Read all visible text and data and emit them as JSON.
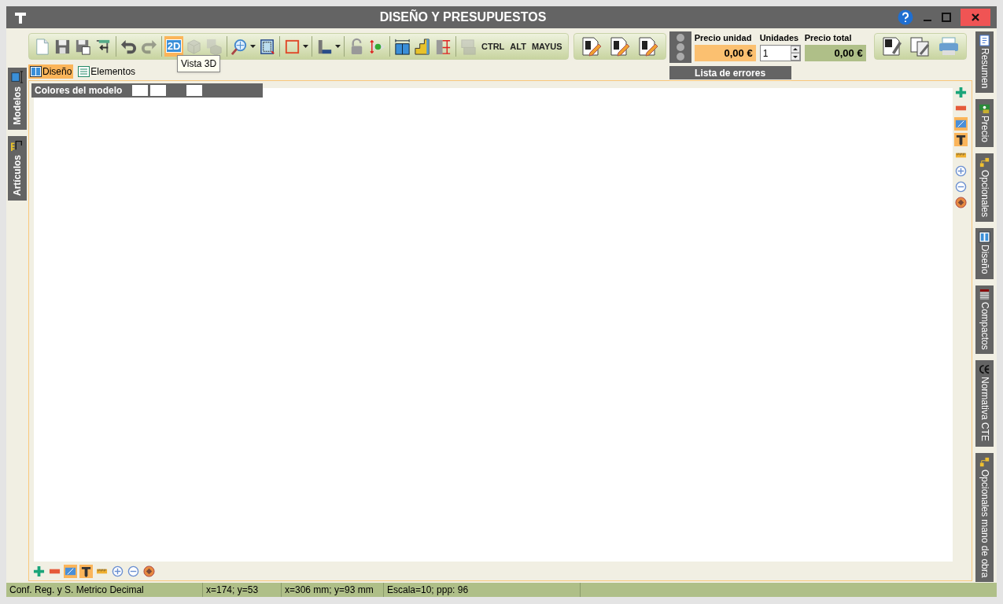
{
  "window": {
    "title": "DISEÑO Y PRESUPUESTOS"
  },
  "toolbar": {
    "sections": [
      [
        {
          "kind": "icon",
          "disabled": false,
          "selected": false
        },
        {
          "kind": "icon",
          "disabled": false,
          "selected": false
        },
        {
          "kind": "icon",
          "disabled": false,
          "selected": false
        },
        {
          "kind": "icon",
          "disabled": false,
          "selected": false
        }
      ],
      [
        {
          "kind": "icon",
          "disabled": false,
          "selected": false
        },
        {
          "kind": "icon",
          "disabled": true,
          "selected": false
        }
      ],
      [
        {
          "kind": "text",
          "label": "2D",
          "disabled": false,
          "selected": true
        },
        {
          "kind": "icon",
          "disabled": true,
          "selected": false
        },
        {
          "kind": "icon",
          "disabled": true,
          "selected": false
        }
      ],
      [
        {
          "kind": "dropdown",
          "disabled": false,
          "selected": false
        },
        {
          "kind": "icon",
          "disabled": false,
          "selected": false
        }
      ],
      [
        {
          "kind": "dropdown",
          "disabled": false,
          "selected": false
        }
      ],
      [
        {
          "kind": "dropdown",
          "disabled": false,
          "selected": false
        }
      ],
      [
        {
          "kind": "icon",
          "disabled": false,
          "selected": false
        },
        {
          "kind": "icon",
          "disabled": false,
          "selected": false
        }
      ],
      [
        {
          "kind": "icon",
          "disabled": false,
          "selected": false
        },
        {
          "kind": "icon",
          "disabled": false,
          "selected": false
        },
        {
          "kind": "icon",
          "disabled": false,
          "selected": false
        }
      ],
      [
        {
          "kind": "icon",
          "disabled": true,
          "selected": false
        },
        {
          "kind": "text",
          "label": "CTRL",
          "disabled": false,
          "selected": false
        },
        {
          "kind": "text",
          "label": "ALT",
          "disabled": false,
          "selected": false
        },
        {
          "kind": "text",
          "label": "MAYUS",
          "disabled": false,
          "selected": false
        }
      ]
    ]
  },
  "tooltip": "Vista 3D",
  "report_buttons": [
    {
      "kind": "icon"
    },
    {
      "kind": "icon"
    },
    {
      "kind": "icon"
    }
  ],
  "price": {
    "unit_label": "Precio unidad",
    "unit_value": "0,00 €",
    "units_label": "Unidades",
    "units_value": "1",
    "total_label": "Precio total",
    "total_value": "0,00 €"
  },
  "errors_button": "Lista de errores",
  "print_buttons": [
    {
      "kind": "icon"
    },
    {
      "kind": "icon"
    },
    {
      "kind": "icon"
    }
  ],
  "view_tabs": [
    {
      "label": "Diseño",
      "selected": true
    },
    {
      "label": "Elementos",
      "selected": false
    }
  ],
  "model_colors": {
    "title": "Colores del modelo",
    "swatches": [
      {
        "color": "#ffffff"
      },
      {
        "color": "#ffffff"
      },
      {
        "color": "#ffffff"
      }
    ]
  },
  "left_tabs": [
    {
      "label": "Modelos"
    },
    {
      "label": "Artículos"
    }
  ],
  "right_tabs": [
    {
      "label": "Resumen"
    },
    {
      "label": "Precio"
    },
    {
      "label": "Opcionales"
    },
    {
      "label": "Diseño"
    },
    {
      "label": "Compactos"
    },
    {
      "label": "Normativa CTE"
    },
    {
      "label": "Opcionales mano de obra"
    }
  ],
  "canvas_tools": [
    {
      "selected": false
    },
    {
      "selected": false
    },
    {
      "selected": true
    },
    {
      "selected": true
    },
    {
      "selected": false
    },
    {
      "selected": false
    },
    {
      "selected": false
    },
    {
      "selected": false
    }
  ],
  "status_bar": [
    "Conf. Reg. y S. Metrico Decimal",
    "x=174; y=53",
    "x=306 mm; y=93 mm",
    "Escala=10; ppp: 96"
  ]
}
